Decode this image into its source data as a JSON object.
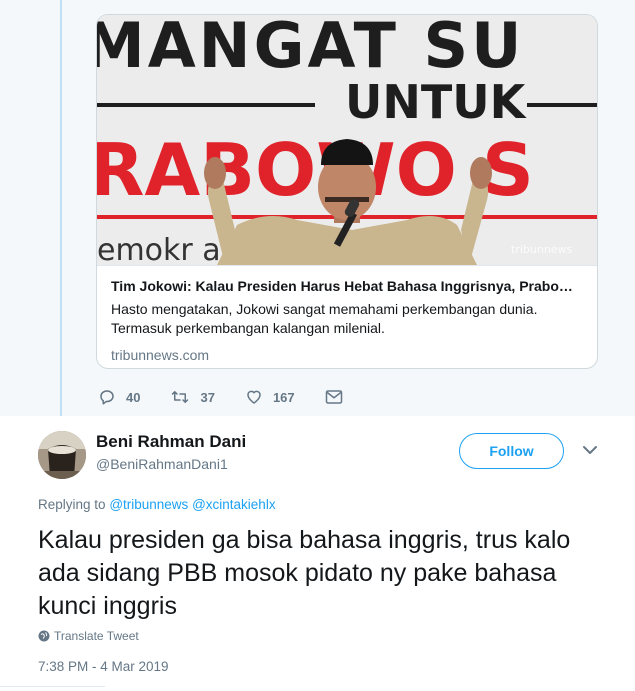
{
  "quoted_card": {
    "image_text": {
      "line1": "MANGAT SU",
      "line2": "UNTUK",
      "line3": "RABOWO S",
      "line4": "emokr          ab  Me",
      "watermark": "tribunnews"
    },
    "title": "Tim Jokowi: Kalau Presiden Harus Hebat Bahasa Inggrisnya, Prabo…",
    "description": "Hasto mengatakan, Jokowi sangat memahami perkembangan dunia. Termasuk perkembangan kalangan milenial.",
    "domain": "tribunnews.com"
  },
  "actions": {
    "replies": "40",
    "retweets": "37",
    "likes": "167"
  },
  "tweet": {
    "display_name": "Beni Rahman Dani",
    "handle": "@BeniRahmanDani1",
    "follow_label": "Follow",
    "replying_prefix": "Replying to",
    "replying_users": [
      "@tribunnews",
      "@xcintakiehlx"
    ],
    "text": "Kalau presiden ga bisa bahasa inggris, trus kalo ada sidang PBB mosok pidato ny pake bahasa kunci inggris",
    "translate_label": "Translate Tweet",
    "timestamp": "7:38 PM - 4 Mar 2019"
  },
  "icons": [
    "reply-icon",
    "retweet-icon",
    "like-icon",
    "message-icon",
    "chevron-down-icon",
    "globe-icon"
  ],
  "colors": {
    "accent": "#1da1f2",
    "muted": "#657786",
    "background_top": "#f5f8fa",
    "banner_red": "#e0232b"
  }
}
